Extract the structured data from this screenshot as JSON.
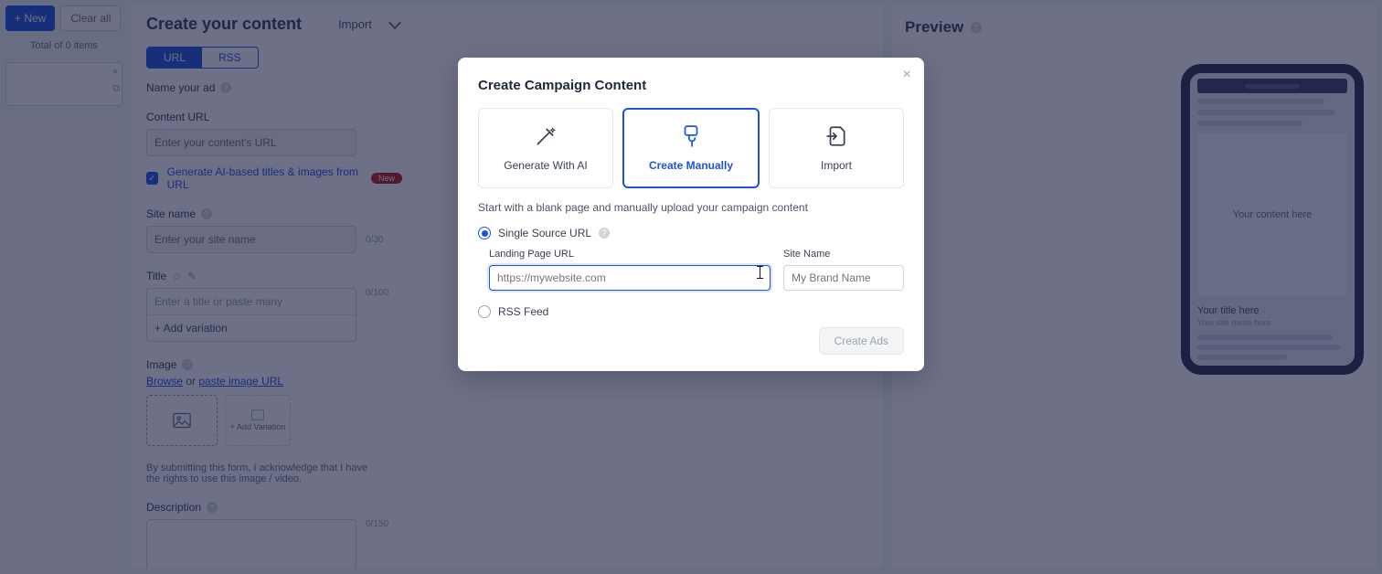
{
  "left": {
    "newBtn": "+ New",
    "clearBtn": "Clear all",
    "total": "Total of 0 items"
  },
  "main": {
    "title": "Create your content",
    "importLabel": "Import",
    "toggleUrl": "URL",
    "toggleRss": "RSS",
    "sections": {
      "nameAd": "Name your ad",
      "contentUrlLabel": "Content URL",
      "contentUrlPlaceholder": "Enter your content's URL",
      "aiCheckbox": "Generate AI-based titles & images from URL",
      "newBadge": "New",
      "siteNameLabel": "Site name",
      "siteNamePlaceholder": "Enter your site name",
      "siteNameCounter": "0/30",
      "titleLabel": "Title",
      "titlePlaceholder": "Enter a title or paste many",
      "addVariationLinkT": "+ Add variation",
      "titleCounter": "0/100",
      "imageLabel": "Image",
      "browse": "Browse",
      "or": " or ",
      "pasteUrl": "paste image URL",
      "addVariationImg": "+ Add Variation",
      "note": "By submitting this form, I acknowledge that I have the rights to use this image / video.",
      "descLabel": "Description",
      "descCounter": "0/150"
    }
  },
  "preview": {
    "title": "Preview",
    "contentPlaceholder": "Your content here",
    "titlePlaceholder": "Your title here",
    "subPlaceholder": "Your site name here"
  },
  "modal": {
    "title": "Create Campaign Content",
    "options": {
      "ai": "Generate With AI",
      "manual": "Create Manually",
      "import": "Import"
    },
    "description": "Start with a blank page and manually upload your campaign content",
    "radioSingle": "Single Source URL",
    "radioRss": "RSS Feed",
    "landingLabel": "Landing Page URL",
    "landingPlaceholder": "https://mywebsite.com",
    "siteLabel": "Site Name",
    "sitePlaceholder": "My Brand Name",
    "createBtn": "Create Ads"
  }
}
